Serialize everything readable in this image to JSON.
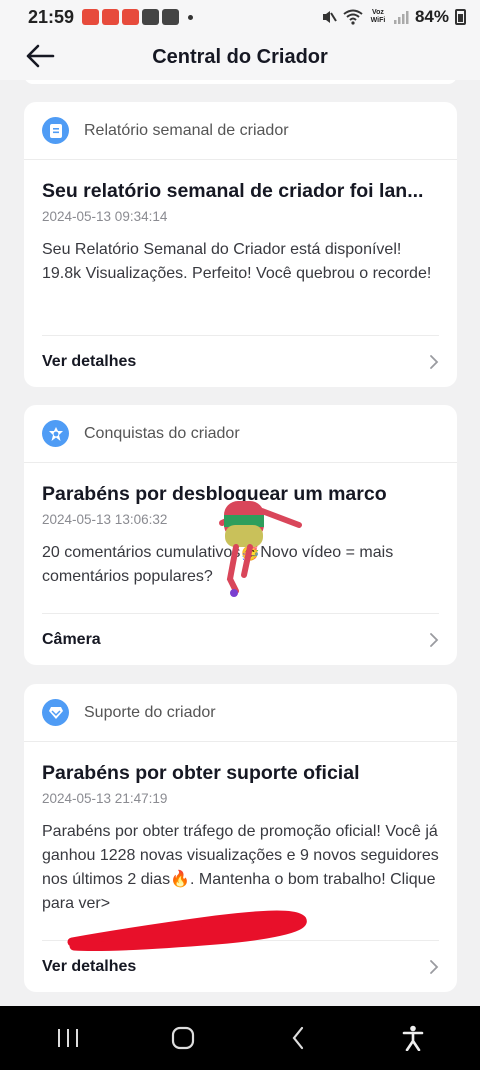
{
  "status_bar": {
    "time": "21:59",
    "battery": "84%",
    "network_label": "Voz WiFi"
  },
  "header": {
    "title": "Central do Criador"
  },
  "cards": [
    {
      "category": "Relatório semanal de criador",
      "icon": "report-icon",
      "title": "Seu relatório semanal de criador foi lan...",
      "date": "2024-05-13 09:34:14",
      "text": "Seu Relatório Semanal do Criador está disponível! 19.8k Visualizações. Perfeito! Você quebrou o recorde!",
      "action": "Ver detalhes"
    },
    {
      "category": "Conquistas do criador",
      "icon": "achievement-icon",
      "title": "Parabéns por desbloquear um marco",
      "date": "2024-05-13 13:06:32",
      "text": "20 comentários cumulativos🥳Novo vídeo = mais comentários populares?",
      "action": "Câmera"
    },
    {
      "category": "Suporte do criador",
      "icon": "support-diamond-icon",
      "title": "Parabéns por obter suporte oficial",
      "date": "2024-05-13 21:47:19",
      "text": "Parabéns por obter tráfego de promoção oficial! Você já ganhou 1228 novas visualizações e 9 novos seguidores nos últimos 2 dias🔥. Mantenha o bom trabalho! Clique para ver>",
      "action": "Ver detalhes"
    }
  ],
  "colors": {
    "accent": "#4f9cf5",
    "background": "#f1f1f2",
    "card": "#ffffff",
    "scribble": "#e8102a"
  }
}
